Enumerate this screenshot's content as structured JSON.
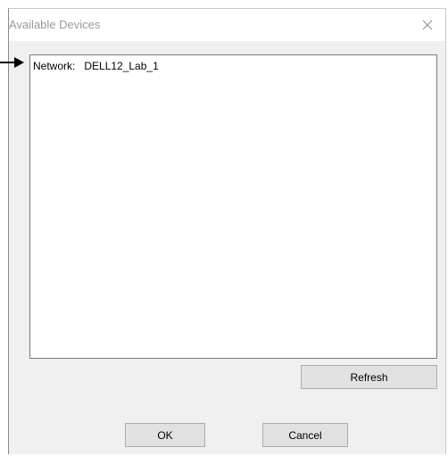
{
  "window": {
    "title": "Available Devices",
    "close_icon": "close-icon"
  },
  "device_list": {
    "items": [
      {
        "label": "Network:   DELL12_Lab_1"
      }
    ]
  },
  "buttons": {
    "refresh_label": "Refresh",
    "ok_label": "OK",
    "cancel_label": "Cancel"
  },
  "annotation": {
    "icon": "arrow-right-icon"
  }
}
